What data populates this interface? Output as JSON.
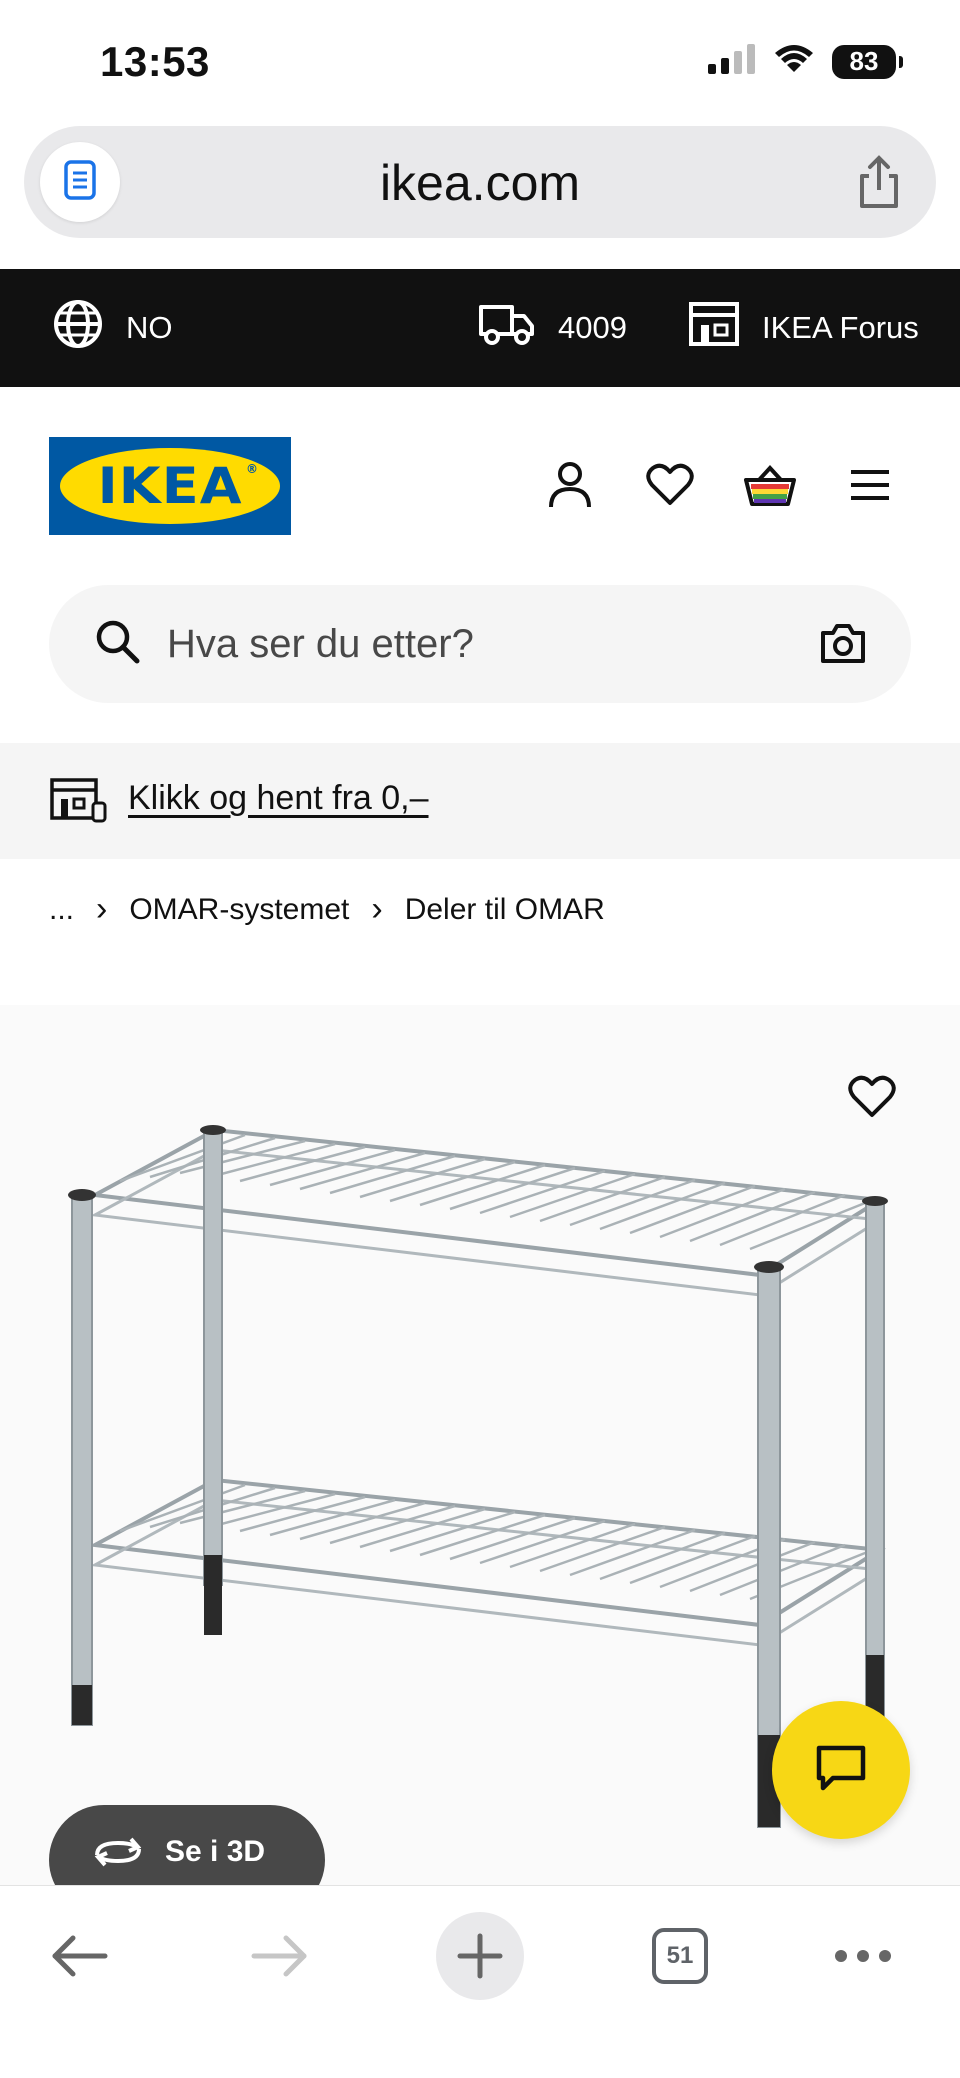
{
  "status_bar": {
    "time": "13:53",
    "battery": "83",
    "icons": [
      "signal-icon",
      "wifi-icon",
      "battery-icon"
    ]
  },
  "browser": {
    "url": "ikea.com",
    "reader_icon": "reader-mode-icon",
    "share_icon": "share-icon"
  },
  "top_strip": {
    "language": "NO",
    "postcode": "4009",
    "store": "IKEA Forus"
  },
  "header": {
    "logo_text": "IKEA",
    "icons": [
      "user-icon",
      "heart-icon",
      "basket-icon",
      "menu-icon"
    ]
  },
  "search": {
    "placeholder": "Hva ser du etter?"
  },
  "promo": {
    "link_text": "Klikk og hent fra 0,–"
  },
  "breadcrumb": {
    "ellipsis": "...",
    "items": [
      "OMAR-systemet",
      "Deler til OMAR"
    ]
  },
  "product": {
    "view_3d_label": "Se i 3D"
  },
  "bottom_bar": {
    "tabs_count": "51"
  },
  "colors": {
    "ikea_blue": "#0058a3",
    "ikea_yellow": "#ffdb00",
    "chat_yellow": "#f7d715",
    "strip_black": "#111111",
    "pill_gray": "#484848"
  }
}
